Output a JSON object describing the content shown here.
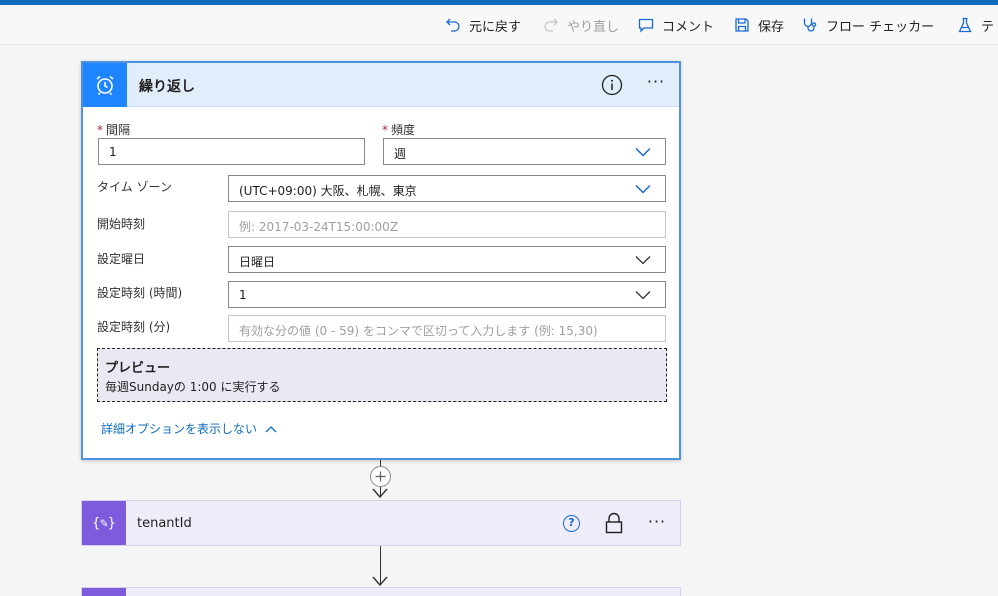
{
  "toolbar": {
    "undo": "元に戻す",
    "redo": "やり直し",
    "comment": "コメント",
    "save": "保存",
    "flow_checker": "フロー チェッカー",
    "test": "テ"
  },
  "recurrence": {
    "title": "繰り返し",
    "interval": {
      "label": "間隔",
      "required": "*",
      "value": "1"
    },
    "frequency": {
      "label": "頻度",
      "required": "*",
      "value": "週"
    },
    "timezone": {
      "label": "タイム ゾーン",
      "value": "(UTC+09:00) 大阪、札幌、東京"
    },
    "start_time": {
      "label": "開始時刻",
      "placeholder": "例: 2017-03-24T15:00:00Z"
    },
    "weekdays": {
      "label": "設定曜日",
      "value": "日曜日"
    },
    "hours": {
      "label": "設定時刻 (時間)",
      "value": "1"
    },
    "minutes": {
      "label": "設定時刻 (分)",
      "placeholder": "有効な分の値 (0 - 59) をコンマで区切って入力します (例: 15,30)"
    },
    "preview": {
      "title": "プレビュー",
      "text": "毎週Sundayの 1:00 に実行する"
    },
    "advanced_link": "詳細オプションを表示しない"
  },
  "variable_card": {
    "title": "tenantId",
    "icon_glyph": "{✎}",
    "help_glyph": "?"
  },
  "icons": {
    "undo": "undo-icon",
    "redo": "redo-icon",
    "comment": "comment-icon",
    "save": "save-icon",
    "checker": "stethoscope-icon",
    "test": "flask-icon",
    "recurrence": "alarm-clock-icon",
    "info": "info-icon",
    "more": "more-icon",
    "lock": "lock-icon"
  },
  "colors": {
    "accent": "#0f6cbd",
    "recurrence_icon_bg": "#1f85ff",
    "variable_icon_bg": "#7d5bdc",
    "required_marker": "#a4262c"
  }
}
